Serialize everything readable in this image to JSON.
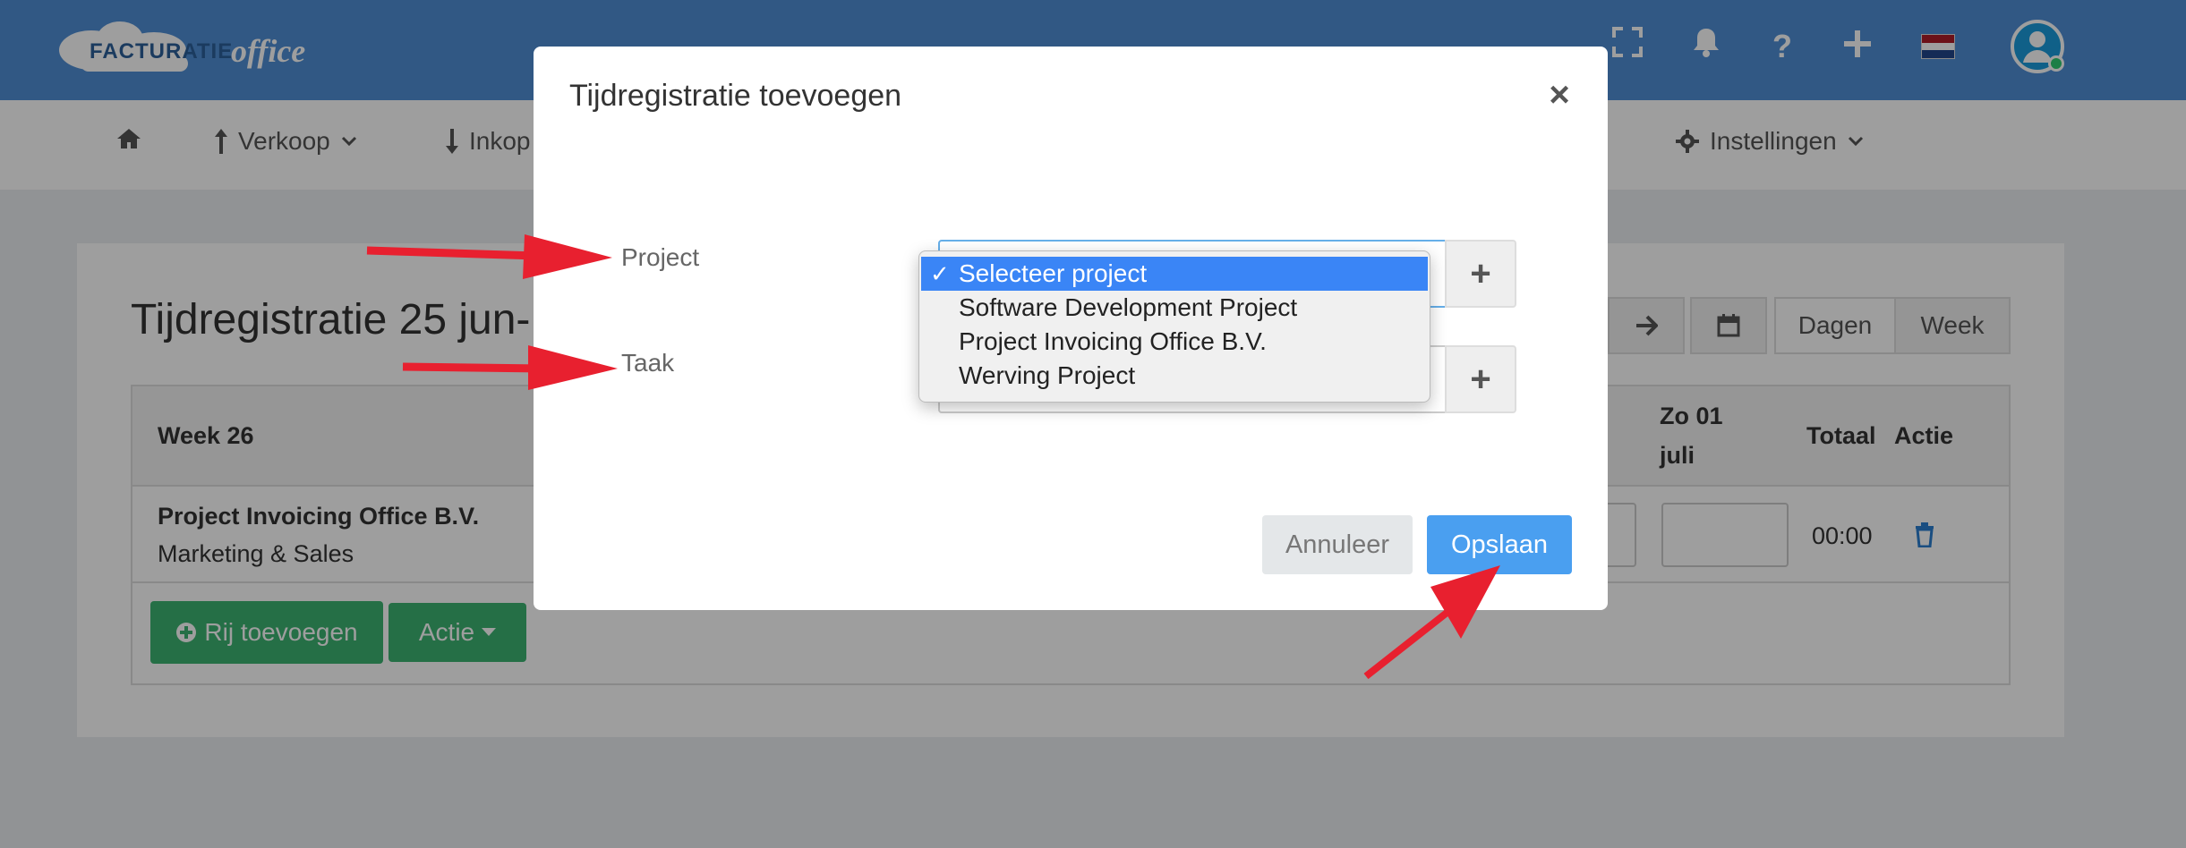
{
  "header": {
    "logo_text_bold": "FACTURATIE",
    "logo_text_script": "office",
    "icons": [
      "fullscreen-icon",
      "bell-icon",
      "help-icon",
      "plus-icon",
      "flag-nl-icon",
      "avatar-icon"
    ],
    "flag_colors": [
      "#ae1c28",
      "#ffffff",
      "#21468b"
    ]
  },
  "nav": {
    "items": [
      {
        "label": "",
        "icon": "home-icon"
      },
      {
        "label": "Verkoop",
        "icon": "arrow-up-icon"
      },
      {
        "label": "Inkop",
        "icon": "arrow-down-icon"
      },
      {
        "label": "Instellingen",
        "icon": "gear-icon"
      }
    ]
  },
  "page": {
    "title": "Tijdregistratie 25 jun-",
    "view_buttons": [
      "Dagen",
      "Week"
    ],
    "table": {
      "headers": [
        "Week 26",
        "Zo 01",
        "juli",
        "Totaal",
        "Actie"
      ],
      "row": {
        "project": "Project Invoicing Office B.V.",
        "task": "Marketing & Sales",
        "total": "00:00"
      }
    },
    "add_row_button": "Rij toevoegen",
    "action_button": "Actie"
  },
  "modal": {
    "title": "Tijdregistratie toevoegen",
    "close": "×",
    "project_label": "Project",
    "task_label": "Taak",
    "add_symbol": "+",
    "cancel_button": "Annuleer",
    "save_button": "Opslaan"
  },
  "dropdown": {
    "options": [
      {
        "label": "Selecteer project",
        "selected": true
      },
      {
        "label": "Software Development Project",
        "selected": false
      },
      {
        "label": "Project Invoicing Office B.V.",
        "selected": false
      },
      {
        "label": "Werving Project",
        "selected": false
      }
    ],
    "check_mark": "✓"
  },
  "colors": {
    "header_bg": "#4f8fd6",
    "primary": "#4a9ff0",
    "success": "#3cb371",
    "arrow": "#e8202f"
  }
}
